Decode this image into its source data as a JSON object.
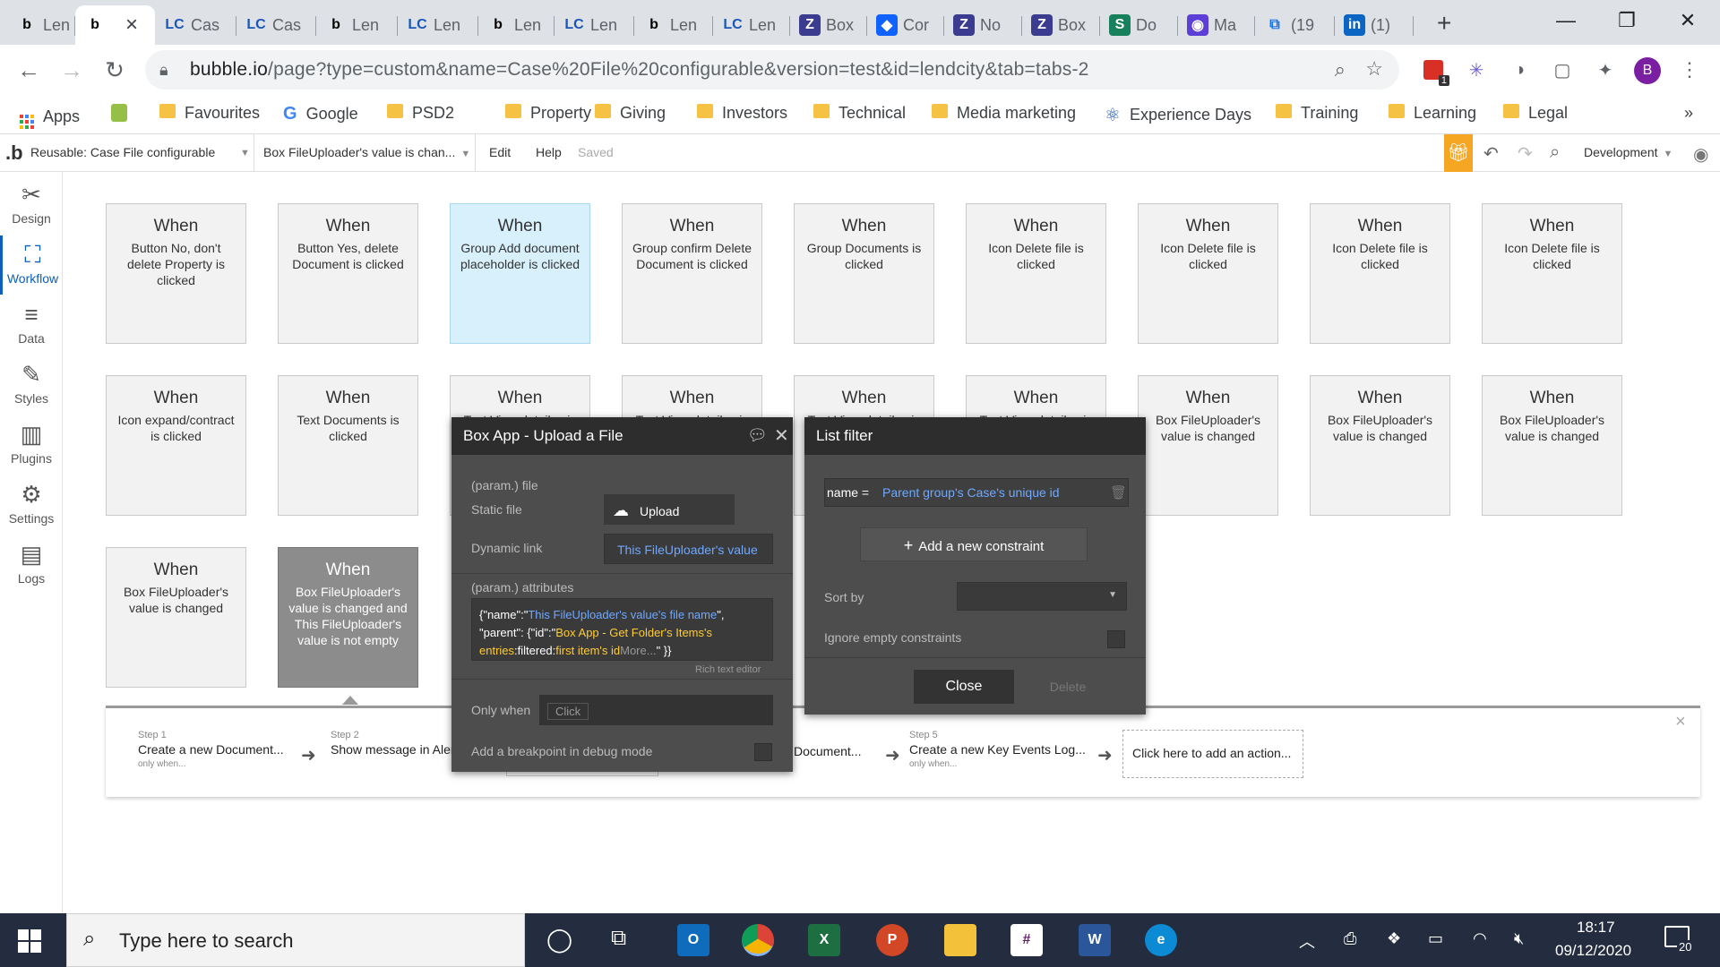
{
  "browser": {
    "tabs": [
      {
        "icon": "b",
        "label": "Len"
      },
      {
        "icon": "b",
        "label": ""
      },
      {
        "icon": "LC",
        "label": "Cas"
      },
      {
        "icon": "LC",
        "label": "Cas"
      },
      {
        "icon": "b",
        "label": "Len"
      },
      {
        "icon": "LC",
        "label": "Len"
      },
      {
        "icon": "b",
        "label": "Len"
      },
      {
        "icon": "LC",
        "label": "Len"
      },
      {
        "icon": "b",
        "label": "Len"
      },
      {
        "icon": "LC",
        "label": "Len"
      },
      {
        "icon": "Z",
        "label": "Box"
      },
      {
        "icon": "◆",
        "label": "Cor"
      },
      {
        "icon": "Z",
        "label": "No"
      },
      {
        "icon": "Z",
        "label": "Box"
      },
      {
        "icon": "S",
        "label": "Do"
      },
      {
        "icon": "◉",
        "label": "Ma"
      },
      {
        "icon": "⧉",
        "label": "(19"
      },
      {
        "icon": "in",
        "label": "(1)"
      }
    ],
    "active_tab_close": "×",
    "new_tab": "+",
    "window_controls": {
      "minimize": "—",
      "restore": "❐",
      "close": "✕"
    },
    "url_host": "bubble.io",
    "url_path": "/page?type=custom&name=Case%20File%20configurable&version=test&id=lendcity&tab=tabs-2",
    "profile_initial": "B",
    "ext_badge": "1"
  },
  "bookmarks": [
    {
      "label": "Apps",
      "icon": "apps-grid-icon"
    },
    {
      "label": "",
      "icon": "shopify-icon"
    },
    {
      "label": "Favourites",
      "icon": "folder-icon"
    },
    {
      "label": "Google",
      "icon": "google-icon"
    },
    {
      "label": "PSD2",
      "icon": "folder-icon"
    },
    {
      "label": "Property",
      "icon": "folder-icon"
    },
    {
      "label": "Giving",
      "icon": "folder-icon"
    },
    {
      "label": "Investors",
      "icon": "folder-icon"
    },
    {
      "label": "Technical",
      "icon": "folder-icon"
    },
    {
      "label": "Media marketing",
      "icon": "folder-icon"
    },
    {
      "label": "Experience Days",
      "icon": "experience-icon"
    },
    {
      "label": "Training",
      "icon": "folder-icon"
    },
    {
      "label": "Learning",
      "icon": "folder-icon"
    },
    {
      "label": "Legal",
      "icon": "folder-icon"
    }
  ],
  "bookmarks_more": "»",
  "editor": {
    "logo": ".b",
    "page_selector": "Reusable: Case File configurable",
    "workflow_selector": "Box FileUploader's value is chan...",
    "menu_edit": "Edit",
    "menu_help": "Help",
    "saved": "Saved",
    "environment": "Development"
  },
  "sidebar": [
    {
      "label": "Design",
      "icon": "design-icon"
    },
    {
      "label": "Workflow",
      "icon": "workflow-icon"
    },
    {
      "label": "Data",
      "icon": "data-icon"
    },
    {
      "label": "Styles",
      "icon": "styles-icon"
    },
    {
      "label": "Plugins",
      "icon": "plugins-icon"
    },
    {
      "label": "Settings",
      "icon": "settings-icon"
    },
    {
      "label": "Logs",
      "icon": "logs-icon"
    }
  ],
  "events": [
    {
      "when": "When",
      "desc": "Button No, don't delete Property is clicked"
    },
    {
      "when": "When",
      "desc": "Button Yes, delete Document is clicked"
    },
    {
      "when": "When",
      "desc": "Group Add document placeholder is clicked"
    },
    {
      "when": "When",
      "desc": "Group confirm Delete Document is clicked"
    },
    {
      "when": "When",
      "desc": "Group Documents is clicked"
    },
    {
      "when": "When",
      "desc": "Icon Delete file is clicked"
    },
    {
      "when": "When",
      "desc": "Icon Delete file is clicked"
    },
    {
      "when": "When",
      "desc": "Icon Delete file is clicked"
    },
    {
      "when": "When",
      "desc": "Icon Delete file is clicked"
    },
    {
      "when": "When",
      "desc": "Icon expand/contract is clicked"
    },
    {
      "when": "When",
      "desc": "Text Documents is clicked"
    },
    {
      "when": "When",
      "desc": "Text View details...is"
    },
    {
      "when": "When",
      "desc": "Text View details...is"
    },
    {
      "when": "When",
      "desc": "Text View details...is"
    },
    {
      "when": "When",
      "desc": "Text View details...is"
    },
    {
      "when": "When",
      "desc": "Box FileUploader's value is changed"
    },
    {
      "when": "When",
      "desc": "Box FileUploader's value is changed"
    },
    {
      "when": "When",
      "desc": "Box FileUploader's value is changed"
    },
    {
      "when": "When",
      "desc": "Box FileUploader's value is changed"
    },
    {
      "when": "When",
      "desc": "Box FileUploader's value is changed and This FileUploader's value is not empty"
    }
  ],
  "steps": [
    {
      "num": "Step 1",
      "title": "Create a new Document...",
      "only": "only when..."
    },
    {
      "num": "Step 2",
      "title": "Show message in Alert",
      "only": ""
    },
    {
      "num": "",
      "title": "Document...",
      "only": ""
    },
    {
      "num": "Step 5",
      "title": "Create a new Key Events Log...",
      "only": "only when..."
    }
  ],
  "add_action": "Click here to add an action...",
  "steps_close": "×",
  "action_popup": {
    "title": "Box App - Upload a File",
    "param_file": "(param.) file",
    "static_file": "Static file",
    "upload_btn": "Upload",
    "dynamic_link": "Dynamic link",
    "dynamic_value": "This FileUploader's value",
    "param_attrs": "(param.) attributes",
    "attr_1": "{\"name\":\"",
    "attr_2": "This FileUploader's value's file name",
    "attr_3": "\",",
    "attr_4": "\"parent\": {\"id\":\"",
    "attr_5": "Box App - Get Folder's Items's entries",
    "attr_6": ":filtered:",
    "attr_7": "first item's id",
    "attr_8": "More...",
    "attr_9": "\" }}",
    "rich_text": "Rich text editor",
    "only_when": "Only when",
    "click": "Click",
    "breakpoint": "Add a breakpoint in debug mode"
  },
  "filter_popup": {
    "title": "List filter",
    "constraint_key": "name =",
    "constraint_value": "Parent group's Case's unique id",
    "add_constraint": "Add a new constraint",
    "sort_by": "Sort by",
    "ignore_empty": "Ignore empty constraints",
    "close": "Close",
    "delete": "Delete"
  },
  "taskbar": {
    "search_placeholder": "Type here to search",
    "time": "18:17",
    "date": "09/12/2020",
    "notif_count": "20"
  }
}
